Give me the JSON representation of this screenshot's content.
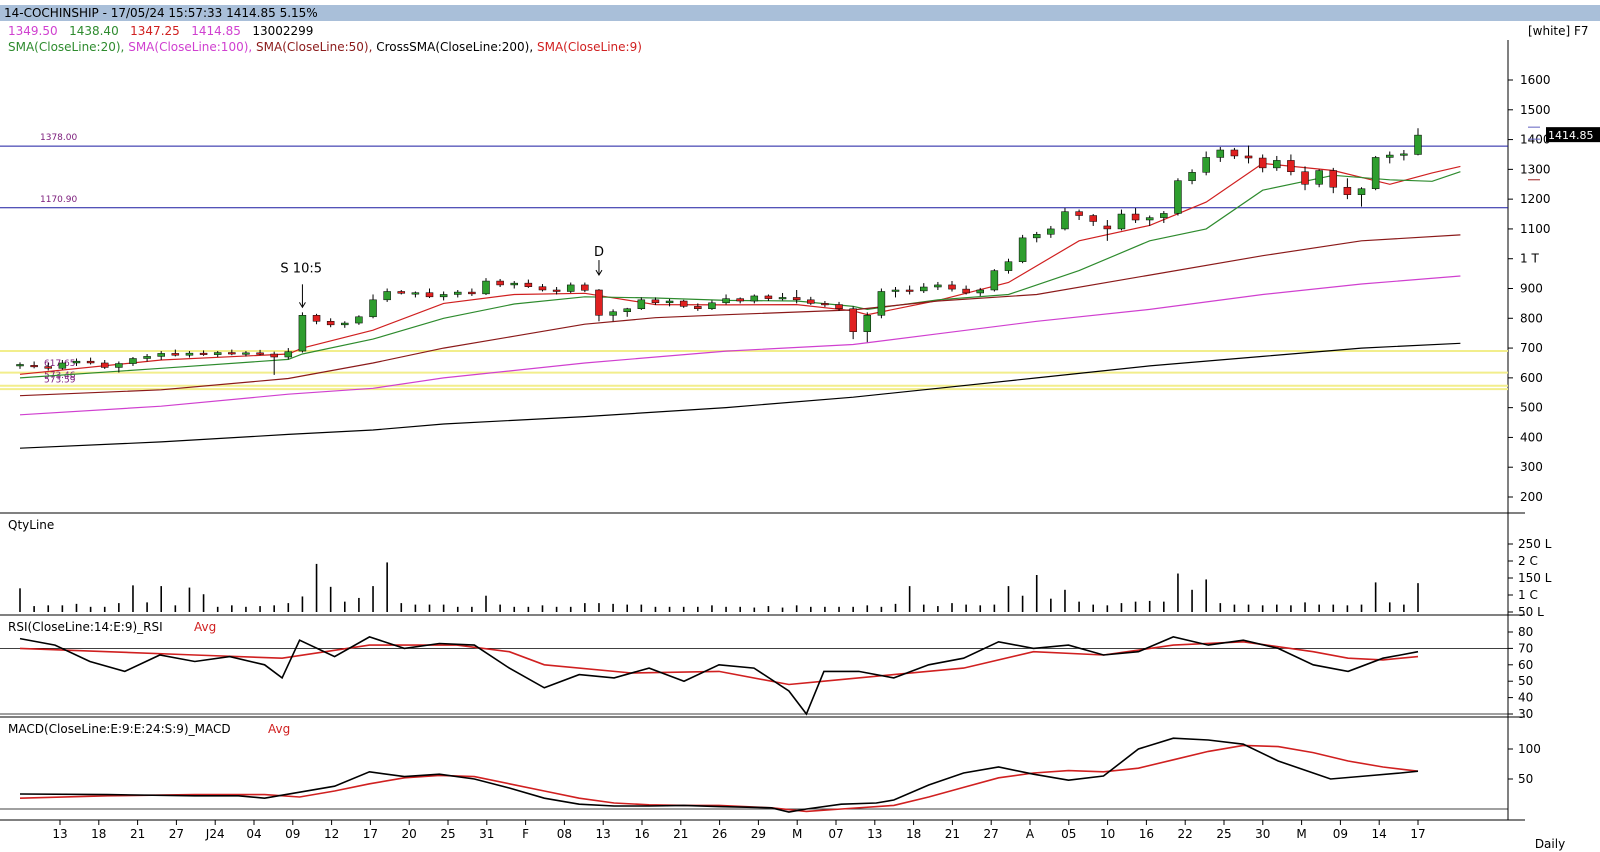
{
  "header": {
    "title": "14-COCHINSHIP - 17/05/24 15:57:33 1414.85 5.15%",
    "theme_tag": "[white] F7"
  },
  "ohlc": {
    "open": "1349.50",
    "high": "1438.40",
    "low": "1347.25",
    "close": "1414.85",
    "volume": "13002299"
  },
  "legend": [
    {
      "label": "SMA(CloseLine:20),",
      "color": "#2e8b2e"
    },
    {
      "label": "SMA(CloseLine:100),",
      "color": "#d040d0"
    },
    {
      "label": "SMA(CloseLine:50),",
      "color": "#8b1a1a"
    },
    {
      "label": "CrossSMA(CloseLine:200),",
      "color": "#000000"
    },
    {
      "label": "SMA(CloseLine:9)",
      "color": "#d02020"
    }
  ],
  "annotations": {
    "split": "S 10:5",
    "dividend": "D",
    "level_1378": "1378.00",
    "level_1170": "1170.90",
    "fib_1": "617.65",
    "fib_2": "573.46",
    "fib_3": "573.59",
    "last_price": "1414.85"
  },
  "panels": {
    "qty": "QtyLine",
    "rsi": "RSI(CloseLine:14:E:9)_RSI",
    "rsi_avg": "Avg",
    "macd": "MACD(CloseLine:E:9:E:24:S:9)_MACD",
    "macd_avg": "Avg",
    "timeframe": "Daily"
  },
  "colors": {
    "up": "#2e9e2e",
    "down": "#e02020",
    "sma20": "#2e8b2e",
    "sma100": "#d040d0",
    "sma50": "#8b1a1a",
    "sma200": "#000000",
    "sma9": "#d02020",
    "hline": "#1a1aa0",
    "fib": "#f2ee8c"
  },
  "chart_data": {
    "type": "candlestick",
    "price_axis": {
      "ticks": [
        "1600",
        "1500",
        "1400",
        "1300",
        "1200",
        "1100",
        "1 T",
        "900",
        "800",
        "700",
        "600",
        "500",
        "400",
        "300",
        "200"
      ],
      "ylim": [
        170,
        1640
      ]
    },
    "volume_axis": {
      "ticks": [
        "250 L",
        "2 C",
        "150 L",
        "1 C",
        "50 L"
      ]
    },
    "rsi_axis": {
      "ticks": [
        "80",
        "70",
        "60",
        "50",
        "40",
        "30"
      ],
      "ylim": [
        28,
        82
      ]
    },
    "macd_axis": {
      "ticks": [
        "100",
        "50"
      ],
      "ylim": [
        -20,
        130
      ]
    },
    "x_ticks": [
      "13",
      "18",
      "21",
      "27",
      "J24",
      "04",
      "09",
      "12",
      "17",
      "20",
      "25",
      "31",
      "F",
      "08",
      "13",
      "16",
      "21",
      "26",
      "29",
      "M",
      "07",
      "13",
      "18",
      "21",
      "27",
      "A",
      "05",
      "10",
      "16",
      "22",
      "25",
      "30",
      "M",
      "09",
      "14",
      "17"
    ],
    "horizontal_levels": [
      1378,
      1170.9
    ],
    "fib_levels": [
      690,
      617.65,
      573.59,
      562
    ],
    "candles": [
      [
        640,
        652,
        630,
        645
      ],
      [
        642,
        655,
        632,
        638
      ],
      [
        638,
        650,
        625,
        632
      ],
      [
        632,
        660,
        628,
        650
      ],
      [
        650,
        665,
        640,
        656
      ],
      [
        656,
        668,
        645,
        650
      ],
      [
        650,
        660,
        630,
        635
      ],
      [
        635,
        655,
        618,
        648
      ],
      [
        648,
        670,
        640,
        665
      ],
      [
        665,
        680,
        655,
        672
      ],
      [
        672,
        690,
        660,
        682
      ],
      [
        682,
        695,
        672,
        676
      ],
      [
        676,
        690,
        668,
        683
      ],
      [
        683,
        692,
        674,
        678
      ],
      [
        678,
        690,
        670,
        685
      ],
      [
        685,
        695,
        676,
        680
      ],
      [
        680,
        690,
        672,
        684
      ],
      [
        684,
        694,
        676,
        680
      ],
      [
        680,
        688,
        610,
        670
      ],
      [
        670,
        700,
        662,
        688
      ],
      [
        690,
        820,
        685,
        810
      ],
      [
        810,
        815,
        780,
        790
      ],
      [
        790,
        800,
        770,
        778
      ],
      [
        778,
        790,
        768,
        784
      ],
      [
        784,
        810,
        778,
        805
      ],
      [
        805,
        880,
        800,
        862
      ],
      [
        862,
        900,
        855,
        890
      ],
      [
        890,
        895,
        880,
        884
      ],
      [
        884,
        890,
        870,
        886
      ],
      [
        886,
        900,
        868,
        872
      ],
      [
        872,
        890,
        860,
        880
      ],
      [
        880,
        895,
        870,
        888
      ],
      [
        888,
        900,
        875,
        882
      ],
      [
        882,
        935,
        878,
        925
      ],
      [
        925,
        932,
        905,
        912
      ],
      [
        912,
        925,
        900,
        918
      ],
      [
        918,
        930,
        902,
        906
      ],
      [
        906,
        915,
        890,
        895
      ],
      [
        895,
        905,
        880,
        890
      ],
      [
        890,
        920,
        885,
        912
      ],
      [
        912,
        920,
        888,
        894
      ],
      [
        895,
        898,
        790,
        810
      ],
      [
        810,
        830,
        790,
        822
      ],
      [
        822,
        835,
        805,
        832
      ],
      [
        832,
        870,
        828,
        862
      ],
      [
        862,
        870,
        845,
        852
      ],
      [
        852,
        865,
        840,
        858
      ],
      [
        858,
        862,
        835,
        840
      ],
      [
        840,
        850,
        825,
        832
      ],
      [
        832,
        860,
        828,
        852
      ],
      [
        852,
        880,
        846,
        866
      ],
      [
        866,
        870,
        850,
        858
      ],
      [
        858,
        880,
        850,
        875
      ],
      [
        875,
        880,
        858,
        866
      ],
      [
        866,
        885,
        860,
        870
      ],
      [
        870,
        895,
        850,
        862
      ],
      [
        862,
        872,
        845,
        850
      ],
      [
        850,
        858,
        838,
        846
      ],
      [
        846,
        855,
        825,
        832
      ],
      [
        832,
        840,
        730,
        755
      ],
      [
        755,
        820,
        720,
        810
      ],
      [
        810,
        900,
        800,
        890
      ],
      [
        890,
        905,
        870,
        895
      ],
      [
        895,
        910,
        880,
        892
      ],
      [
        892,
        918,
        885,
        905
      ],
      [
        905,
        922,
        895,
        912
      ],
      [
        912,
        925,
        890,
        898
      ],
      [
        898,
        910,
        880,
        885
      ],
      [
        885,
        902,
        875,
        895
      ],
      [
        895,
        965,
        890,
        960
      ],
      [
        960,
        1000,
        950,
        990
      ],
      [
        990,
        1080,
        985,
        1070
      ],
      [
        1070,
        1090,
        1055,
        1082
      ],
      [
        1082,
        1110,
        1070,
        1100
      ],
      [
        1100,
        1170,
        1095,
        1158
      ],
      [
        1158,
        1165,
        1130,
        1145
      ],
      [
        1145,
        1150,
        1110,
        1125
      ],
      [
        1110,
        1130,
        1060,
        1100
      ],
      [
        1100,
        1165,
        1095,
        1150
      ],
      [
        1150,
        1170,
        1120,
        1130
      ],
      [
        1130,
        1145,
        1110,
        1138
      ],
      [
        1138,
        1160,
        1120,
        1152
      ],
      [
        1152,
        1270,
        1145,
        1262
      ],
      [
        1262,
        1300,
        1250,
        1290
      ],
      [
        1290,
        1360,
        1280,
        1340
      ],
      [
        1340,
        1375,
        1325,
        1365
      ],
      [
        1365,
        1372,
        1335,
        1345
      ],
      [
        1345,
        1380,
        1320,
        1338
      ],
      [
        1338,
        1350,
        1290,
        1305
      ],
      [
        1305,
        1345,
        1295,
        1330
      ],
      [
        1330,
        1350,
        1280,
        1292
      ],
      [
        1292,
        1310,
        1230,
        1250
      ],
      [
        1250,
        1300,
        1240,
        1296
      ],
      [
        1296,
        1305,
        1220,
        1240
      ],
      [
        1240,
        1270,
        1200,
        1215
      ],
      [
        1215,
        1240,
        1175,
        1235
      ],
      [
        1235,
        1345,
        1230,
        1340
      ],
      [
        1340,
        1360,
        1320,
        1348
      ],
      [
        1348,
        1365,
        1330,
        1352
      ],
      [
        1350,
        1438,
        1347,
        1415
      ]
    ],
    "sma": {
      "sma9": [
        [
          0,
          612
        ],
        [
          10,
          660
        ],
        [
          19,
          680
        ],
        [
          20,
          700
        ],
        [
          25,
          760
        ],
        [
          30,
          850
        ],
        [
          35,
          880
        ],
        [
          40,
          884
        ],
        [
          45,
          846
        ],
        [
          50,
          845
        ],
        [
          55,
          846
        ],
        [
          59,
          825
        ],
        [
          60,
          812
        ],
        [
          65,
          860
        ],
        [
          70,
          920
        ],
        [
          75,
          1060
        ],
        [
          80,
          1112
        ],
        [
          84,
          1190
        ],
        [
          88,
          1320
        ],
        [
          93,
          1296
        ],
        [
          97,
          1250
        ],
        [
          100,
          1288
        ],
        [
          102,
          1310
        ]
      ],
      "sma20": [
        [
          0,
          600
        ],
        [
          10,
          632
        ],
        [
          19,
          662
        ],
        [
          20,
          680
        ],
        [
          25,
          730
        ],
        [
          30,
          800
        ],
        [
          35,
          848
        ],
        [
          40,
          872
        ],
        [
          45,
          868
        ],
        [
          50,
          860
        ],
        [
          55,
          858
        ],
        [
          59,
          840
        ],
        [
          60,
          830
        ],
        [
          65,
          862
        ],
        [
          70,
          880
        ],
        [
          75,
          960
        ],
        [
          80,
          1060
        ],
        [
          84,
          1100
        ],
        [
          88,
          1230
        ],
        [
          93,
          1280
        ],
        [
          97,
          1265
        ],
        [
          100,
          1260
        ],
        [
          102,
          1292
        ]
      ],
      "sma50": [
        [
          0,
          540
        ],
        [
          10,
          560
        ],
        [
          19,
          598
        ],
        [
          25,
          650
        ],
        [
          30,
          700
        ],
        [
          35,
          740
        ],
        [
          40,
          780
        ],
        [
          45,
          802
        ],
        [
          50,
          812
        ],
        [
          59,
          828
        ],
        [
          65,
          858
        ],
        [
          72,
          880
        ],
        [
          80,
          945
        ],
        [
          88,
          1010
        ],
        [
          95,
          1060
        ],
        [
          102,
          1080
        ]
      ],
      "sma100": [
        [
          0,
          476
        ],
        [
          10,
          505
        ],
        [
          19,
          545
        ],
        [
          25,
          565
        ],
        [
          30,
          600
        ],
        [
          40,
          650
        ],
        [
          50,
          690
        ],
        [
          59,
          712
        ],
        [
          65,
          748
        ],
        [
          72,
          790
        ],
        [
          80,
          830
        ],
        [
          88,
          880
        ],
        [
          95,
          915
        ],
        [
          102,
          942
        ]
      ],
      "sma200": [
        [
          0,
          364
        ],
        [
          10,
          385
        ],
        [
          19,
          410
        ],
        [
          25,
          425
        ],
        [
          30,
          445
        ],
        [
          40,
          470
        ],
        [
          50,
          500
        ],
        [
          59,
          535
        ],
        [
          65,
          565
        ],
        [
          72,
          600
        ],
        [
          80,
          640
        ],
        [
          88,
          672
        ],
        [
          95,
          700
        ],
        [
          102,
          716
        ]
      ]
    },
    "volume": [
      32,
      8,
      9,
      9,
      11,
      7,
      7,
      12,
      36,
      13,
      35,
      9,
      33,
      24,
      7,
      9,
      7,
      8,
      9,
      12,
      21,
      65,
      34,
      14,
      19,
      35,
      67,
      12,
      10,
      10,
      10,
      7,
      7,
      22,
      10,
      7,
      7,
      9,
      7,
      7,
      12,
      12,
      11,
      10,
      10,
      7,
      7,
      7,
      7,
      9,
      7,
      7,
      6,
      8,
      6,
      9,
      7,
      7,
      7,
      7,
      9,
      7,
      11,
      35,
      10,
      8,
      12,
      10,
      9,
      10,
      35,
      22,
      50,
      18,
      30,
      14,
      10,
      9,
      12,
      14,
      15,
      14,
      52,
      30,
      44,
      12,
      10,
      10,
      9,
      10,
      9,
      13,
      10,
      10,
      9,
      10,
      40,
      13,
      10,
      39
    ],
    "rsi": [
      [
        0,
        76
      ],
      [
        4,
        72
      ],
      [
        8,
        62
      ],
      [
        12,
        56
      ],
      [
        16,
        66
      ],
      [
        20,
        62
      ],
      [
        24,
        65
      ],
      [
        28,
        60
      ],
      [
        30,
        52
      ],
      [
        32,
        75
      ],
      [
        36,
        65
      ],
      [
        40,
        77
      ],
      [
        44,
        70
      ],
      [
        48,
        73
      ],
      [
        52,
        72
      ],
      [
        56,
        58
      ],
      [
        60,
        46
      ],
      [
        64,
        54
      ],
      [
        68,
        52
      ],
      [
        72,
        58
      ],
      [
        76,
        50
      ],
      [
        80,
        60
      ],
      [
        84,
        58
      ],
      [
        88,
        44
      ],
      [
        90,
        30
      ],
      [
        92,
        56
      ],
      [
        96,
        56
      ],
      [
        100,
        52
      ],
      [
        104,
        60
      ],
      [
        108,
        64
      ],
      [
        112,
        74
      ],
      [
        116,
        70
      ],
      [
        120,
        72
      ],
      [
        124,
        66
      ],
      [
        128,
        68
      ],
      [
        132,
        77
      ],
      [
        136,
        72
      ],
      [
        140,
        75
      ],
      [
        144,
        70
      ],
      [
        148,
        60
      ],
      [
        152,
        56
      ],
      [
        156,
        64
      ],
      [
        158,
        66
      ],
      [
        160,
        68
      ]
    ],
    "rsi_avg": [
      [
        0,
        70
      ],
      [
        10,
        68
      ],
      [
        20,
        66
      ],
      [
        30,
        64
      ],
      [
        40,
        72
      ],
      [
        50,
        72
      ],
      [
        56,
        68
      ],
      [
        60,
        60
      ],
      [
        70,
        55
      ],
      [
        80,
        56
      ],
      [
        88,
        48
      ],
      [
        92,
        50
      ],
      [
        100,
        54
      ],
      [
        108,
        58
      ],
      [
        116,
        68
      ],
      [
        124,
        66
      ],
      [
        132,
        72
      ],
      [
        140,
        74
      ],
      [
        148,
        68
      ],
      [
        152,
        64
      ],
      [
        156,
        63
      ],
      [
        160,
        65
      ]
    ]
  }
}
